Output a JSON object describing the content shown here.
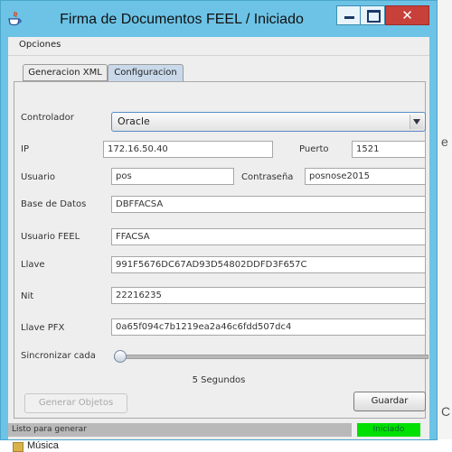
{
  "window": {
    "title": "Firma de Documentos FEEL / Iniciado"
  },
  "menu": {
    "items": [
      "Opciones"
    ]
  },
  "tabs": [
    "Generacion XML",
    "Configuracion"
  ],
  "form": {
    "controlador": {
      "label": "Controlador",
      "value": "Oracle"
    },
    "ip": {
      "label": "IP",
      "value": "172.16.50.40"
    },
    "puerto": {
      "label": "Puerto",
      "value": "1521"
    },
    "usuario": {
      "label": "Usuario",
      "value": "pos"
    },
    "contrasena": {
      "label": "Contraseña",
      "value": "posnose2015"
    },
    "base_de_datos": {
      "label": "Base de Datos",
      "value": "DBFFACSA"
    },
    "usuario_feel": {
      "label": "Usuario FEEL",
      "value": "FFACSA"
    },
    "llave": {
      "label": "Llave",
      "value": "991F5676DC67AD93D54802DDFD3F657C"
    },
    "nit": {
      "label": "Nit",
      "value": "22216235"
    },
    "llave_pfx": {
      "label": "Llave PFX",
      "value": "0a65f094c7b1219ea2a46c6fdd507dc4"
    },
    "sincronizar": {
      "label": "Sincronizar cada",
      "value_fraction": 0.0
    },
    "interval_text": "5 Segundos"
  },
  "buttons": {
    "generar": "Generar Objetos",
    "guardar": "Guardar"
  },
  "status": {
    "message": "Listo para generar",
    "badge": "Iniciado"
  },
  "background": {
    "letters": [
      "e",
      "C"
    ],
    "taskbar_item": "Música"
  },
  "colors": {
    "titlebar": "#6cc3e6",
    "status_badge": "#00e000",
    "close_button": "#c8403a"
  }
}
